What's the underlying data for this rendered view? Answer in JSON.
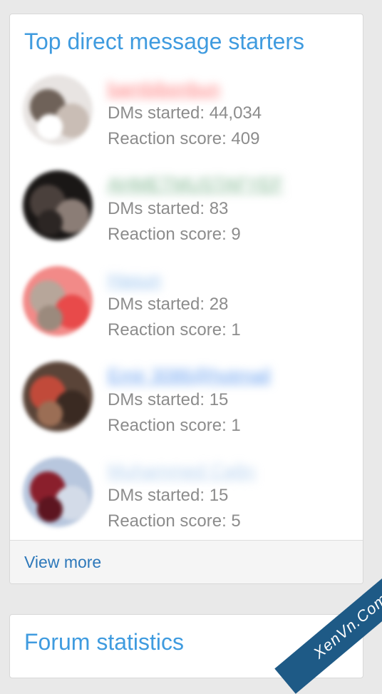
{
  "block": {
    "title": "Top direct message starters",
    "view_more": "View more"
  },
  "members": [
    {
      "name": "bambibonbun",
      "name_color": "#ff7a7a",
      "dms_label": "DMs started: 44,034",
      "reaction_label": "Reaction score: 409",
      "avatar_colors": [
        "#e8e4e2",
        "#6f6259",
        "#c9bdb5",
        "#ffffff"
      ]
    },
    {
      "name": "AHMETMUSTAFYEF",
      "name_color": "#7fb58f",
      "dms_label": "DMs started: 83",
      "reaction_label": "Reaction score: 9",
      "avatar_colors": [
        "#1a1716",
        "#4a403c",
        "#8b7d76",
        "#2c2624"
      ]
    },
    {
      "name": "Hasun",
      "name_color": "#9cc4ee",
      "dms_label": "DMs started: 28",
      "reaction_label": "Reaction score: 1",
      "avatar_colors": [
        "#f28a88",
        "#b7a69a",
        "#e84a4a",
        "#9b8a7d"
      ]
    },
    {
      "name": "Emir 3086@hotmail",
      "name_color": "#6aa1f0",
      "dms_label": "DMs started: 15",
      "reaction_label": "Reaction score: 1",
      "avatar_colors": [
        "#5a4438",
        "#c14a3a",
        "#3a2a22",
        "#9b6e55"
      ]
    },
    {
      "name": "Muhammed Çağrı",
      "name_color": "#b7d2ef",
      "dms_label": "DMs started: 15",
      "reaction_label": "Reaction score: 5",
      "avatar_colors": [
        "#b8c7de",
        "#8a1f2c",
        "#d3dbe8",
        "#5d1520"
      ]
    }
  ],
  "stats_block": {
    "title": "Forum statistics"
  },
  "watermark": {
    "text": "XenVn.Com"
  },
  "colors": {
    "title_blue": "#3f9bdf",
    "link_blue": "#2d78ba",
    "stat_gray": "#8c8c8c",
    "page_bg": "#e9e9e9"
  }
}
